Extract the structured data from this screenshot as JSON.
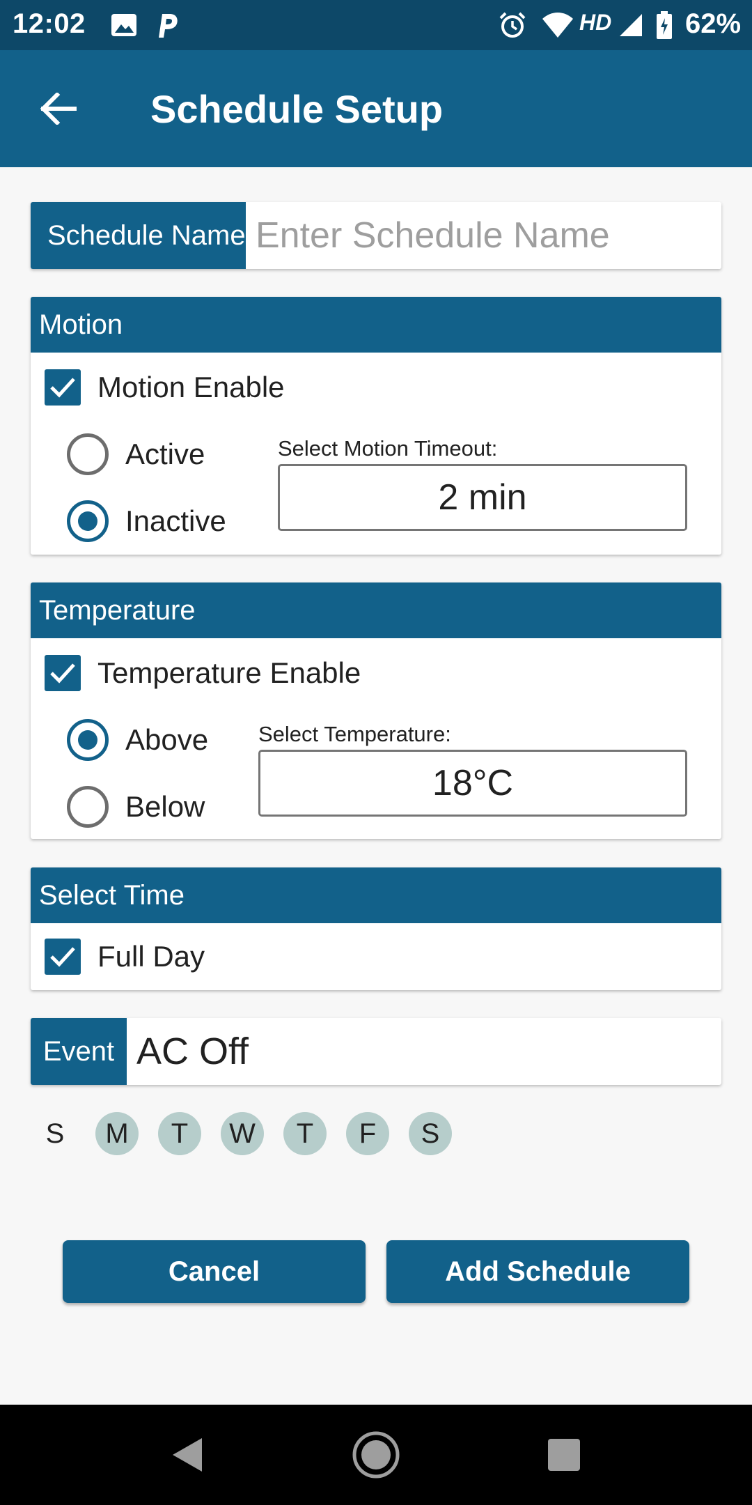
{
  "status_bar": {
    "time": "12:02",
    "network_label": "HD",
    "battery_percent": "62%",
    "icons": [
      "image-icon",
      "parking-icon",
      "alarm-icon",
      "wifi-icon",
      "signal-icon",
      "battery-icon"
    ]
  },
  "app_bar": {
    "title": "Schedule Setup",
    "back_icon": "arrow-left-icon"
  },
  "schedule_name": {
    "label": "Schedule Name",
    "placeholder": "Enter Schedule Name",
    "value": ""
  },
  "motion": {
    "header": "Motion",
    "enable_label": "Motion Enable",
    "enabled": true,
    "options": [
      {
        "label": "Active",
        "selected": false
      },
      {
        "label": "Inactive",
        "selected": true
      }
    ],
    "timeout_label": "Select Motion Timeout:",
    "timeout_value": "2 min"
  },
  "temperature": {
    "header": "Temperature",
    "enable_label": "Temperature Enable",
    "enabled": true,
    "options": [
      {
        "label": "Above",
        "selected": true
      },
      {
        "label": "Below",
        "selected": false
      }
    ],
    "select_label": "Select Temperature:",
    "value": "18°C"
  },
  "time": {
    "header": "Select Time",
    "full_day_label": "Full Day",
    "full_day": true
  },
  "event": {
    "label": "Event",
    "value": "AC Off"
  },
  "days": [
    {
      "label": "S",
      "selected": false
    },
    {
      "label": "M",
      "selected": true
    },
    {
      "label": "T",
      "selected": true
    },
    {
      "label": "W",
      "selected": true
    },
    {
      "label": "T",
      "selected": true
    },
    {
      "label": "F",
      "selected": true
    },
    {
      "label": "S",
      "selected": true
    }
  ],
  "buttons": {
    "cancel": "Cancel",
    "add": "Add Schedule"
  },
  "colors": {
    "primary": "#12618a",
    "status_bar": "#0d4868",
    "day_selected": "#b6cdcb",
    "background": "#f7f7f7"
  }
}
